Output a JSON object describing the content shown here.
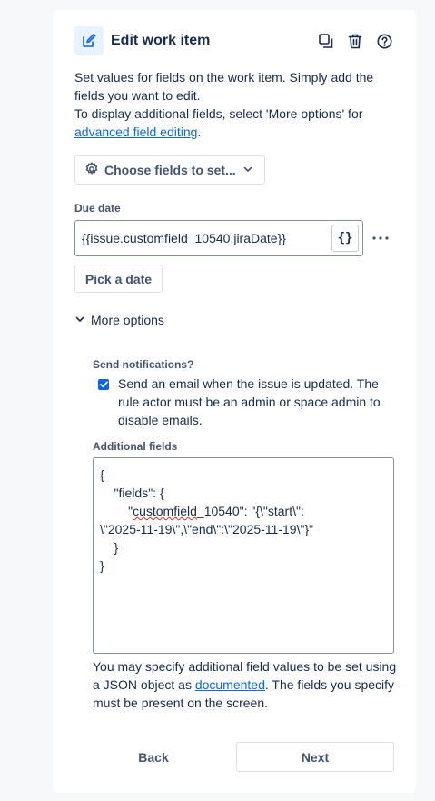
{
  "header": {
    "title": "Edit work item",
    "icon": "edit-pencil-icon",
    "actions": [
      "duplicate-icon",
      "trash-icon",
      "help-icon"
    ]
  },
  "description": {
    "line1": "Set values for fields on the work item. Simply add the fields you want to edit.",
    "line2_prefix": "To display additional fields, select 'More options' for ",
    "line2_link": "advanced field editing",
    "line2_suffix": "."
  },
  "choose_fields": {
    "label": "Choose fields to set..."
  },
  "due_date": {
    "label": "Due date",
    "value": "{{issue.customfield_10540.jiraDate}}",
    "braces_label": "{}",
    "pick_label": "Pick a date"
  },
  "more_options": {
    "label": "More options"
  },
  "notifications": {
    "label": "Send notifications?",
    "checked": true,
    "text": "Send an email when the issue is updated. The rule actor must be an admin or space admin to disable emails."
  },
  "additional_fields": {
    "label": "Additional fields",
    "lines": {
      "l1": "{",
      "l2": "    \"fields\": {",
      "l3_indent": "        \"",
      "l3_word": "customfield",
      "l3_rest": "_10540\": \"{\\\"start\\\":",
      "l4": "\\\"2025-11-19\\\",\\\"end\\\":\\\"2025-11-19\\\"}\"",
      "l5": "    }",
      "l6": "}"
    },
    "help_prefix": "You may specify additional field values to be set using a JSON object as ",
    "help_link": "documented",
    "help_suffix": ". The fields you specify must be present on the screen."
  },
  "footer": {
    "back_label": "Back",
    "next_label": "Next"
  },
  "colors": {
    "accent": "#0c66e4",
    "text": "#172b4d",
    "subtle": "#44546f"
  }
}
